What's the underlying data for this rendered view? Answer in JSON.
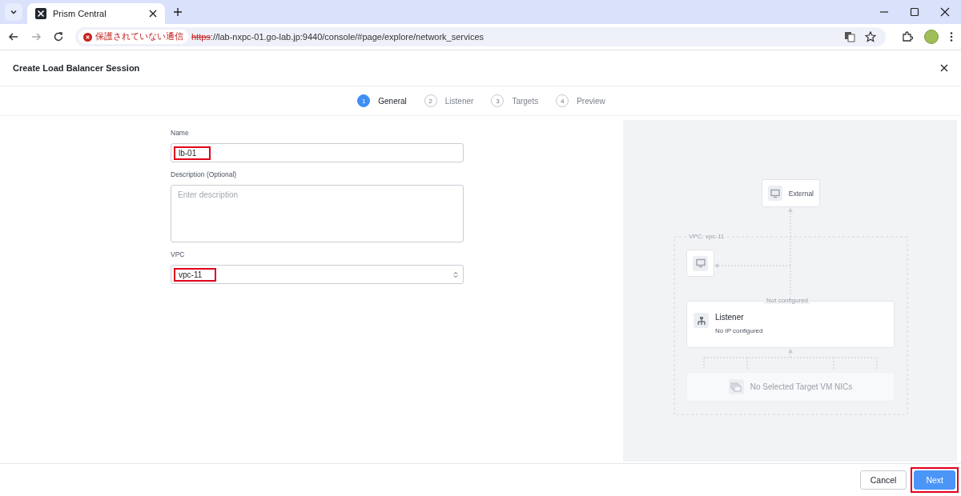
{
  "browser": {
    "tab_title": "Prism Central",
    "security_label": "保護されていない通信",
    "url_scheme": "https",
    "url_rest": "://lab-nxpc-01.go-lab.jp:9440/console/#page/explore/network_services"
  },
  "dialog": {
    "title": "Create Load Balancer Session"
  },
  "steps": [
    {
      "number": "1",
      "label": "General",
      "selected": true
    },
    {
      "number": "2",
      "label": "Listener",
      "selected": false
    },
    {
      "number": "3",
      "label": "Targets",
      "selected": false
    },
    {
      "number": "4",
      "label": "Preview",
      "selected": false
    }
  ],
  "fields": [
    {
      "kind": "text",
      "label": "Name",
      "value": "lb-01",
      "highlighted": true
    },
    {
      "kind": "textarea",
      "label": "Description (Optional)",
      "placeholder": "Enter description",
      "highlighted": false
    },
    {
      "kind": "select",
      "label": "VPC",
      "value": "vpc-11",
      "highlighted": true
    }
  ],
  "diagram": {
    "external": "External",
    "vpc_label": "VPC: vpc-11",
    "listener_status": "Not configured",
    "listener_title": "Listener",
    "listener_subtitle": "No IP configured",
    "targets": "No Selected Target VM NICs"
  },
  "buttons": [
    {
      "label": "Cancel",
      "kind": "secondary",
      "highlighted": false
    },
    {
      "label": "Next",
      "kind": "primary",
      "highlighted": true
    }
  ]
}
